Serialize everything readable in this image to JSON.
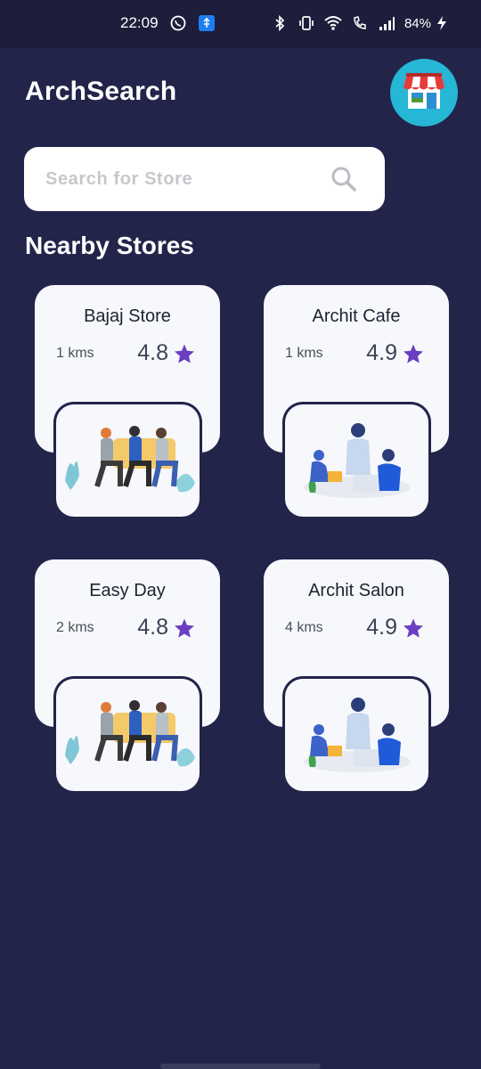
{
  "status_bar": {
    "time": "22:09",
    "battery": "84%",
    "icons_left": [
      "whatsapp-icon",
      "usb-icon"
    ],
    "icons_right": [
      "bluetooth-icon",
      "vibrate-icon",
      "wifi-icon",
      "wifi-calling-icon",
      "signal-icon",
      "charging-icon"
    ]
  },
  "header": {
    "title": "ArchSearch",
    "avatar_icon": "storefront-icon",
    "avatar_color": "#26b6d6"
  },
  "search": {
    "placeholder": "Search for Store",
    "value": ""
  },
  "section_title": "Nearby Stores",
  "stores": [
    {
      "name": "Bajaj Store",
      "distance": "1 kms",
      "rating": "4.8",
      "illustration": "people-sitting-illustration"
    },
    {
      "name": "Archit Cafe",
      "distance": "1 kms",
      "rating": "4.9",
      "illustration": "team-meeting-illustration"
    },
    {
      "name": "Easy Day",
      "distance": "2 kms",
      "rating": "4.8",
      "illustration": "people-sitting-illustration"
    },
    {
      "name": "Archit Salon",
      "distance": "4 kms",
      "rating": "4.9",
      "illustration": "team-meeting-illustration"
    }
  ],
  "colors": {
    "background": "#22244a",
    "card": "#f7f8fc",
    "star": "#6a3fc2",
    "accent": "#26b6d6"
  }
}
